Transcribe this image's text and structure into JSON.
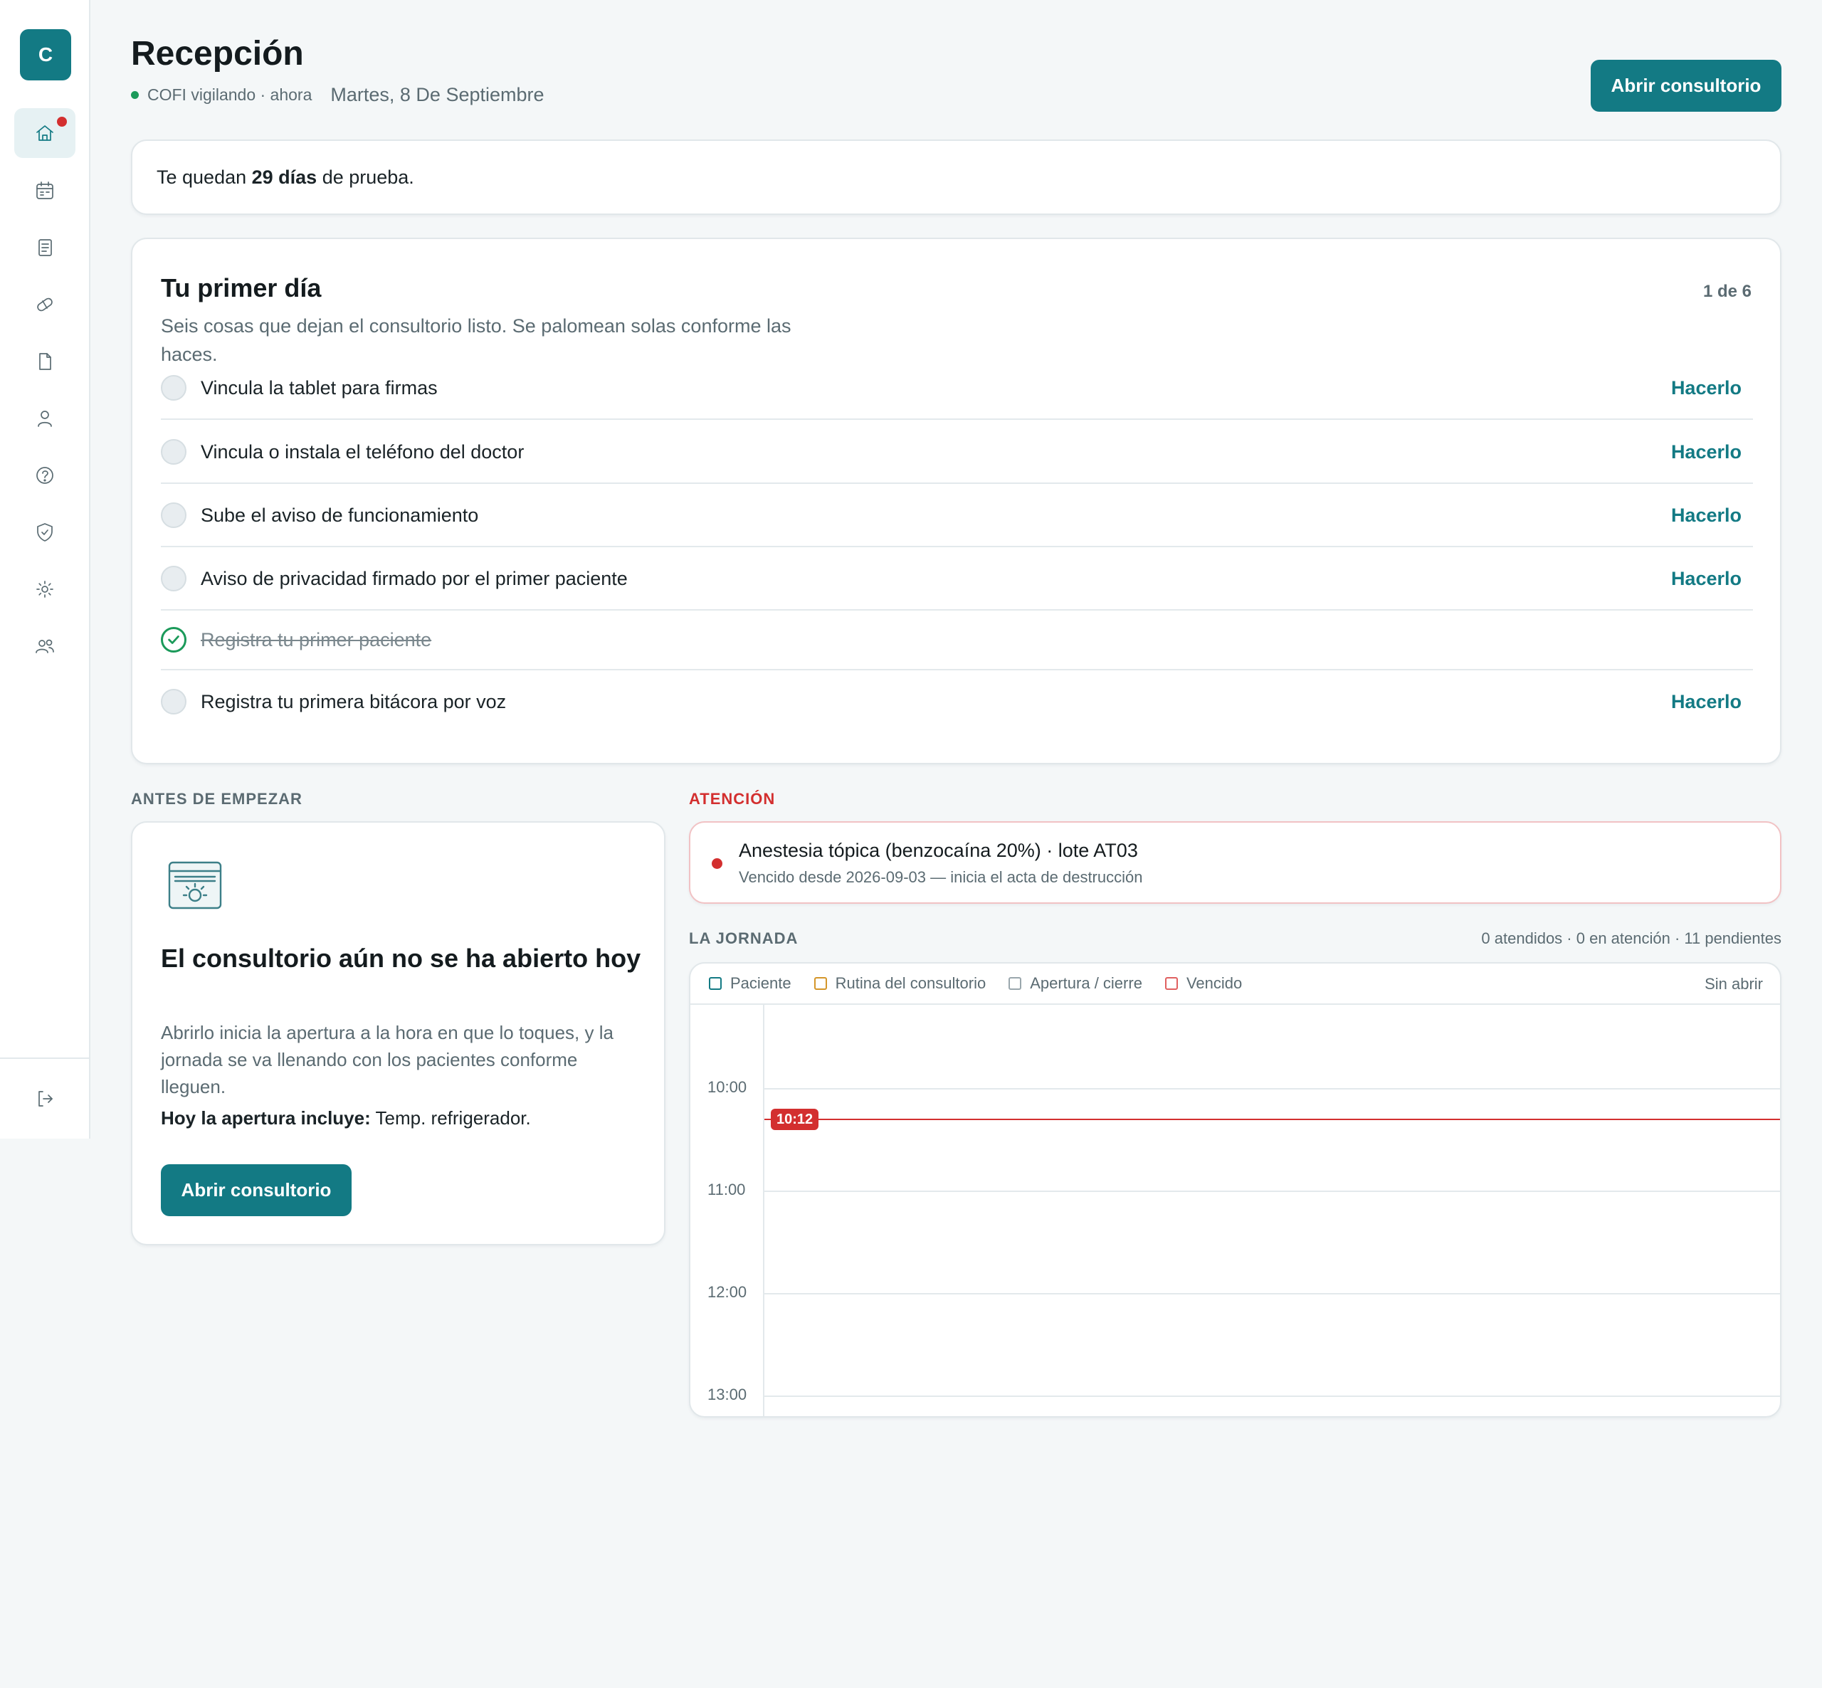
{
  "sidebar": {
    "brand_letter": "C",
    "nav": [
      {
        "name": "home",
        "icon": "home-icon",
        "active": true,
        "has_notification": true
      },
      {
        "name": "calendar",
        "icon": "calendar-icon"
      },
      {
        "name": "records",
        "icon": "document-list-icon"
      },
      {
        "name": "medications",
        "icon": "pill-icon"
      },
      {
        "name": "files",
        "icon": "file-icon"
      },
      {
        "name": "patients",
        "icon": "user-icon"
      },
      {
        "name": "help",
        "icon": "help-icon"
      },
      {
        "name": "compliance",
        "icon": "shield-check-icon"
      },
      {
        "name": "settings",
        "icon": "gear-icon"
      },
      {
        "name": "team",
        "icon": "users-icon"
      }
    ],
    "logout_icon": "logout-icon"
  },
  "header": {
    "title": "Recepción",
    "status": "COFI vigilando · ahora",
    "date": "Martes, 8 De Septiembre",
    "open_button": "Abrir consultorio"
  },
  "trial": {
    "prefix": "Te quedan ",
    "days": "29 días",
    "suffix": " de prueba."
  },
  "first_day": {
    "title": "Tu primer día",
    "progress": "1 de 6",
    "subtitle": "Seis cosas que dejan el consultorio listo. Se palomean solas conforme las haces.",
    "tasks": [
      {
        "label": "Vincula la tablet para firmas",
        "done": false,
        "action": "Hacerlo"
      },
      {
        "label": "Vincula o instala el teléfono del doctor",
        "done": false,
        "action": "Hacerlo"
      },
      {
        "label": "Sube el aviso de funcionamiento",
        "done": false,
        "action": "Hacerlo"
      },
      {
        "label": "Aviso de privacidad firmado por el primer paciente",
        "done": false,
        "action": "Hacerlo"
      },
      {
        "label": "Registra tu primer paciente",
        "done": true,
        "action": ""
      },
      {
        "label": "Registra tu primera bitácora por voz",
        "done": false,
        "action": "Hacerlo"
      }
    ]
  },
  "before_start": {
    "section_label": "ANTES DE EMPEZAR",
    "title": "El consultorio aún no se ha abierto hoy",
    "body": "Abrirlo inicia la apertura a la hora en que lo toques, y la jornada se va llenando con los pacientes conforme lleguen.",
    "includes_label": "Hoy la apertura incluye:",
    "includes_value": " Temp. refrigerador.",
    "button": "Abrir consultorio"
  },
  "attention": {
    "section_label": "ATENCIÓN",
    "item_title": "Anestesia tópica (benzocaína 20%) · lote AT03",
    "item_sub": "Vencido desde 2026-09-03 — inicia el acta de destrucción"
  },
  "journey": {
    "section_label": "LA JORNADA",
    "stats": "0 atendidos · 0 en atención · 11 pendientes",
    "legend": [
      {
        "label": "Paciente",
        "color": "#137a84"
      },
      {
        "label": "Rutina del consultorio",
        "color": "#d4962a"
      },
      {
        "label": "Apertura / cierre",
        "color": "#9aa7ad"
      },
      {
        "label": "Vencido",
        "color": "#e06060"
      }
    ],
    "status": "Sin abrir",
    "hours": [
      "10:00",
      "11:00",
      "12:00",
      "13:00"
    ],
    "now": "10:12"
  },
  "colors": {
    "accent": "#137a84",
    "danger": "#d32f2f",
    "success": "#1b9a5a"
  }
}
